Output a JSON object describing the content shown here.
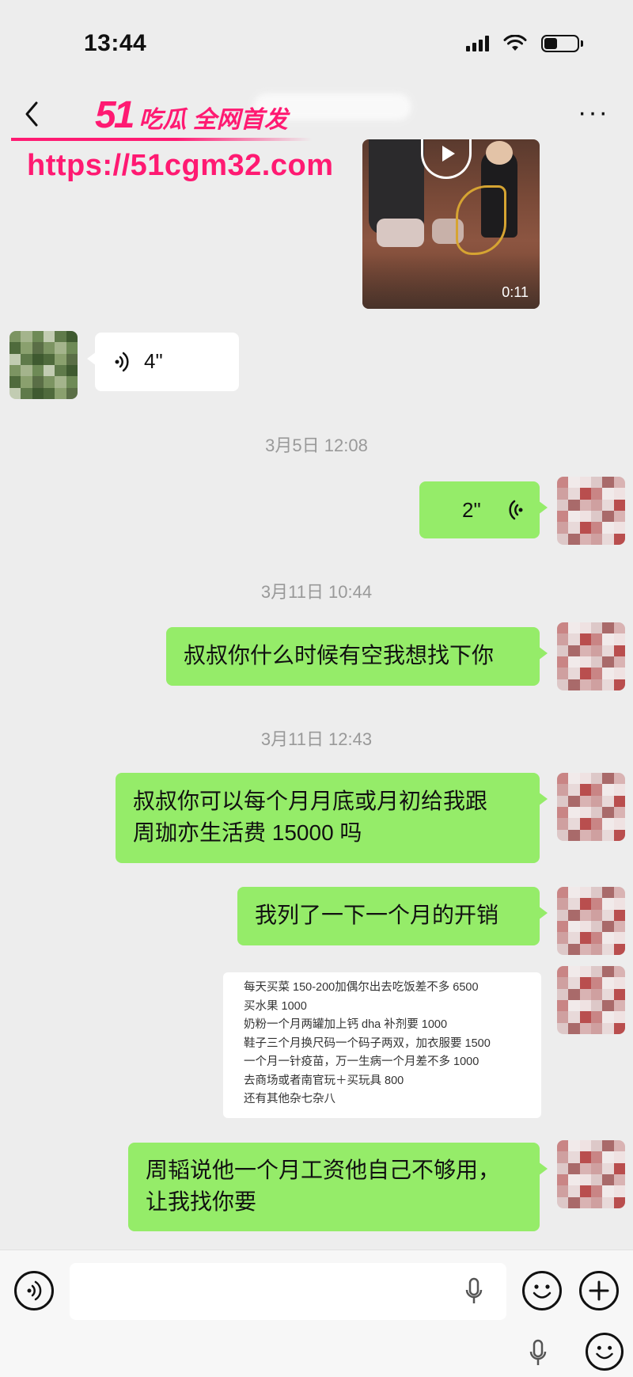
{
  "status_bar": {
    "time": "13:44",
    "battery_level": 0.4
  },
  "nav": {
    "back_icon": "chevron-left-icon",
    "more_icon": "more-horizontal-icon"
  },
  "watermark": {
    "brand_number": "51",
    "brand_text": "吃瓜 全网首发",
    "url": "https://51cgm32.com"
  },
  "video_message": {
    "duration": "0:11"
  },
  "messages": [
    {
      "id": "voice-in",
      "type": "voice",
      "direction": "in",
      "duration": "4\""
    },
    {
      "id": "ts-1",
      "type": "timestamp",
      "text": "3月5日 12:08"
    },
    {
      "id": "voice-out",
      "type": "voice",
      "direction": "out",
      "duration": "2\""
    },
    {
      "id": "ts-2",
      "type": "timestamp",
      "text": "3月11日 10:44"
    },
    {
      "id": "msg-1",
      "type": "text",
      "direction": "out",
      "text": "叔叔你什么时候有空我想找下你"
    },
    {
      "id": "ts-3",
      "type": "timestamp",
      "text": "3月11日 12:43"
    },
    {
      "id": "msg-2",
      "type": "text",
      "direction": "out",
      "lines": [
        "叔叔你可以每个月月底或月初给我跟",
        "周珈亦生活费 15000 吗"
      ]
    },
    {
      "id": "msg-3",
      "type": "text",
      "direction": "out",
      "text": "我列了一下一个月的开销"
    },
    {
      "id": "msg-4",
      "type": "image_text",
      "direction": "out",
      "lines": [
        "每天买菜 150-200加偶尔出去吃饭差不多 6500",
        "买水果 1000",
        "奶粉一个月两罐加上钙 dha 补剂要 1000",
        "鞋子三个月换尺码一个码子两双，加衣服要 1500",
        "一个月一针疫苗，万一生病一个月差不多 1000",
        "去商场或者南官玩＋买玩具 800",
        "还有其他杂七杂八"
      ]
    },
    {
      "id": "msg-5",
      "type": "text",
      "direction": "out",
      "lines": [
        "周韬说他一个月工资他自己不够用，",
        "让我找你要"
      ]
    }
  ],
  "input_bar": {
    "voice_toggle_icon": "voice-mode-icon",
    "mic_icon": "microphone-icon",
    "emoji_icon": "emoji-icon",
    "plus_icon": "plus-icon"
  },
  "colors": {
    "outgoing_bubble": "#95ec69",
    "incoming_bubble": "#ffffff",
    "background": "#ededed",
    "watermark": "#ff1a72"
  }
}
